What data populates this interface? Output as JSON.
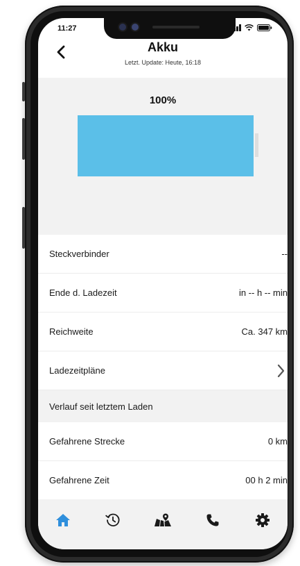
{
  "status_bar": {
    "time": "11:27",
    "signal_icon": "signal-bars-icon",
    "wifi_icon": "wifi-icon",
    "battery_icon": "battery-icon"
  },
  "header": {
    "back_icon": "chevron-left-icon",
    "title": "Akku",
    "subtitle": "Letzt. Update: Heute, 16:18"
  },
  "battery": {
    "percent_label": "100%",
    "level_fraction": 1.0,
    "fill_color": "#5bbfe8"
  },
  "info_rows": [
    {
      "label": "Steckverbinder",
      "value": "--"
    },
    {
      "label": "Ende d. Ladezeit",
      "value": "in -- h -- min"
    },
    {
      "label": "Reichweite",
      "value": "Ca. 347 km"
    },
    {
      "label": "Ladezeitpläne",
      "value": "",
      "icon": "chevron-right-icon"
    }
  ],
  "history_section": {
    "title": "Verlauf seit letztem Laden",
    "rows": [
      {
        "label": "Gefahrene Strecke",
        "value": "0 km"
      },
      {
        "label": "Gefahrene Zeit",
        "value": "00 h 2 min"
      }
    ]
  },
  "tab_bar": {
    "items": [
      {
        "icon": "home-icon",
        "active": true
      },
      {
        "icon": "history-icon",
        "active": false
      },
      {
        "icon": "map-icon",
        "active": false
      },
      {
        "icon": "phone-icon",
        "active": false
      },
      {
        "icon": "settings-gear-icon",
        "active": false
      }
    ],
    "active_color": "#2f8fdc",
    "inactive_color": "#1a1a1a"
  }
}
